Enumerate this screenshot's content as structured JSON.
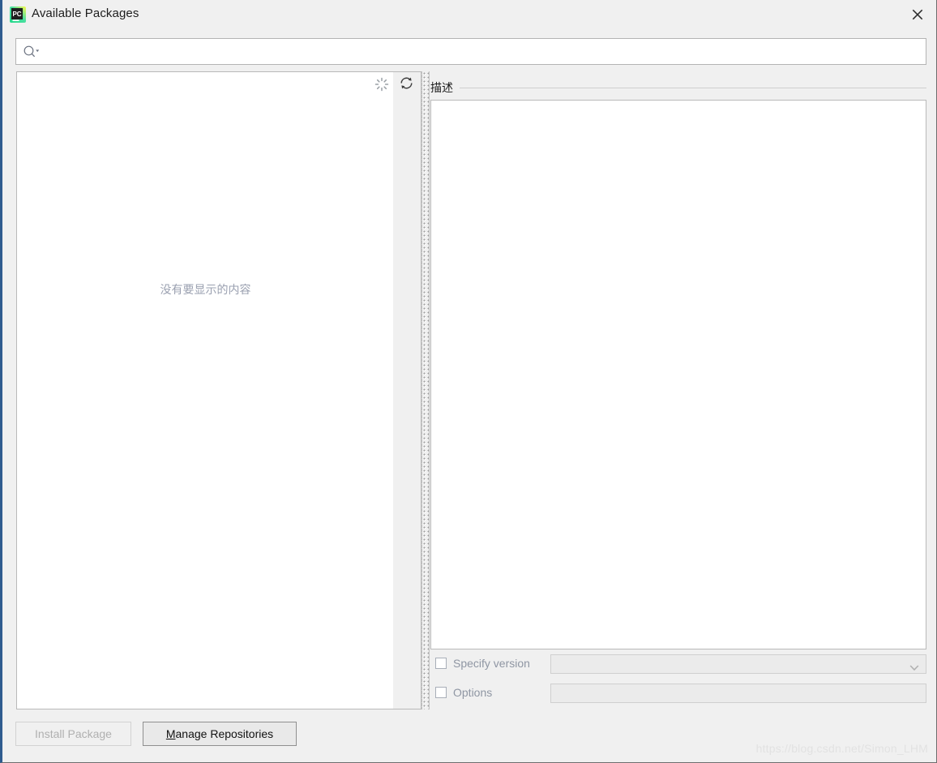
{
  "window": {
    "title": "Available Packages",
    "app_icon": "pycharm-icon",
    "close_icon": "close-icon",
    "accent_border": "#2f5c8f"
  },
  "search": {
    "icon": "search-icon",
    "dropdown_icon": "triangle-down-icon",
    "value": "",
    "placeholder": ""
  },
  "package_list": {
    "empty_text": "没有要显示的内容",
    "toolbar": {
      "loading_icon": "loading-spinner-icon",
      "refresh_icon": "refresh-icon"
    }
  },
  "splitter": {
    "icon": "splitter-handle-dots"
  },
  "description": {
    "title": "描述",
    "body_text": ""
  },
  "options": {
    "specify_version": {
      "label": "Specify version",
      "checked": false,
      "enabled": false,
      "value": "",
      "dropdown_icon": "chevron-down-icon"
    },
    "options_field": {
      "label": "Options",
      "checked": false,
      "enabled": false,
      "value": ""
    }
  },
  "buttons": {
    "install": {
      "label": "Install Package",
      "enabled": false
    },
    "manage": {
      "mnemonic": "M",
      "rest": "anage Repositories",
      "enabled": true
    }
  },
  "watermark": {
    "text": "https://blog.csdn.net/Simon_LHM"
  },
  "colors": {
    "window_bg": "#f0f0f0",
    "panel_bg": "#ffffff",
    "border": "#b9b9b9",
    "disabled_text": "#b0b0b0",
    "placeholder_text": "#9aa0b0"
  }
}
